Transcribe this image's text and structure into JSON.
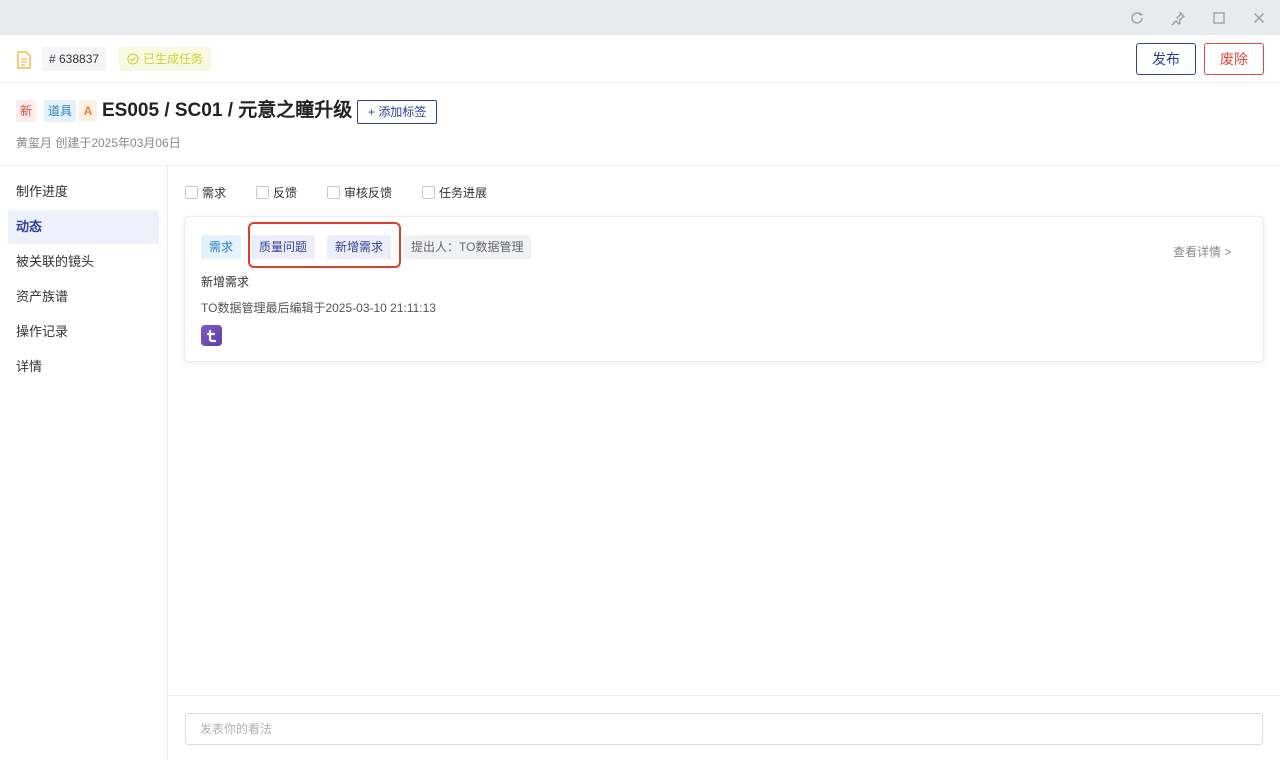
{
  "window": {
    "controls": [
      "refresh-icon",
      "pin-icon",
      "maximize-icon",
      "close-icon"
    ]
  },
  "header": {
    "id_label": "# 638837",
    "status_label": "已生成任务",
    "publish_label": "发布",
    "discard_label": "废除"
  },
  "title_block": {
    "tags": [
      "新",
      "道具",
      "A"
    ],
    "title": "ES005 / SC01 / 元意之瞳升级",
    "add_tag_label": "+ 添加标签",
    "meta": "黄玺月 创建于2025年03月06日"
  },
  "sidebar": {
    "items": [
      {
        "label": "制作进度"
      },
      {
        "label": "动态"
      },
      {
        "label": "被关联的镜头"
      },
      {
        "label": "资产族谱"
      },
      {
        "label": "操作记录"
      },
      {
        "label": "详情"
      }
    ],
    "active_index": 1
  },
  "filters": [
    {
      "label": "需求",
      "checked": false
    },
    {
      "label": "反馈",
      "checked": false
    },
    {
      "label": "审核反馈",
      "checked": false
    },
    {
      "label": "任务进展",
      "checked": false
    }
  ],
  "card": {
    "type_chip": "需求",
    "chips": [
      "质量问题",
      "新增需求"
    ],
    "proposer": "提出人：TO数据管理",
    "view_detail": "查看详情 >",
    "content": "新增需求",
    "edit_meta": "TO数据管理最后编辑于2025-03-10 21:11:13"
  },
  "comment": {
    "placeholder": "发表你的看法"
  },
  "colors": {
    "accent": "#2f3f9a",
    "danger": "#e0493f",
    "highlight": "#d9412f"
  }
}
